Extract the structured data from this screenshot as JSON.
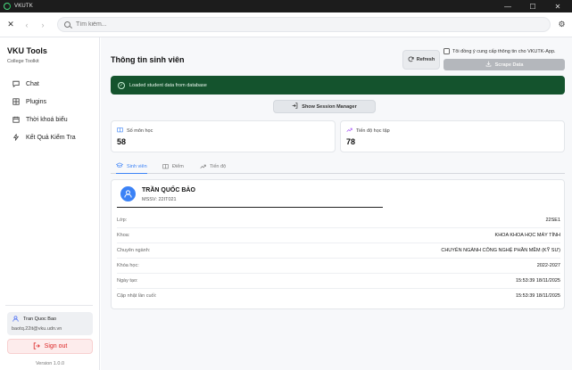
{
  "app": {
    "title": "VKUTK"
  },
  "window": {
    "minimize": "—",
    "maximize": "☐",
    "close": "✕"
  },
  "nav": {
    "search_placeholder": "Tìm kiếm..."
  },
  "sidebar": {
    "brand": "VKU Tools",
    "subtitle": "College Toolkit",
    "items": [
      {
        "label": "Chat",
        "icon": "chat-icon"
      },
      {
        "label": "Plugins",
        "icon": "grid-icon"
      },
      {
        "label": "Thời khoá biểu",
        "icon": "calendar-icon"
      },
      {
        "label": "Kết Quả Kiểm Tra",
        "icon": "activity-icon"
      }
    ],
    "user": {
      "name": "Tran Quoc Bao",
      "email": "baotq.22it@vku.udn.vn"
    },
    "signout": "Sign out",
    "version": "Version 1.0.0"
  },
  "main": {
    "title": "Thông tin sinh viên",
    "refresh_label": "Refresh",
    "consent_label": "Tôi đồng ý cung cấp thông tin cho VKUTK-App.",
    "scrape_label": "Scrape Data",
    "alert": "Loaded student data from database",
    "session_button": "Show Session Manager",
    "stats": [
      {
        "label": "Số môn học",
        "value": "58",
        "icon": "book-icon"
      },
      {
        "label": "Tiến độ học tập",
        "value": "78",
        "icon": "trending-up-icon"
      }
    ],
    "tabs": [
      {
        "label": "Sinh viên",
        "icon": "graduation-cap-icon",
        "active": true
      },
      {
        "label": "Điểm",
        "icon": "book-open-icon",
        "active": false
      },
      {
        "label": "Tiến độ",
        "icon": "trending-up-icon",
        "active": false
      }
    ],
    "student": {
      "name": "TRẦN QUỐC BẢO",
      "id_line": "MSSV: 22IT021",
      "rows": [
        {
          "key": "Lớp:",
          "value": "22SE1"
        },
        {
          "key": "Khoa:",
          "value": "KHOA KHOA HỌC MÁY TÍNH"
        },
        {
          "key": "Chuyên ngành:",
          "value": "CHUYÊN NGÀNH CÔNG NGHỆ PHẦN MỀM (KỸ SƯ)"
        },
        {
          "key": "Khóa học:",
          "value": "2022-2027"
        },
        {
          "key": "Ngày tạo:",
          "value": "15:53:39 18/11/2025"
        },
        {
          "key": "Cập nhật lần cuối:",
          "value": "15:53:39 18/11/2025"
        }
      ]
    }
  },
  "colors": {
    "accent": "#3b82f6",
    "alert_bg": "#14532d",
    "danger": "#dc2626"
  }
}
